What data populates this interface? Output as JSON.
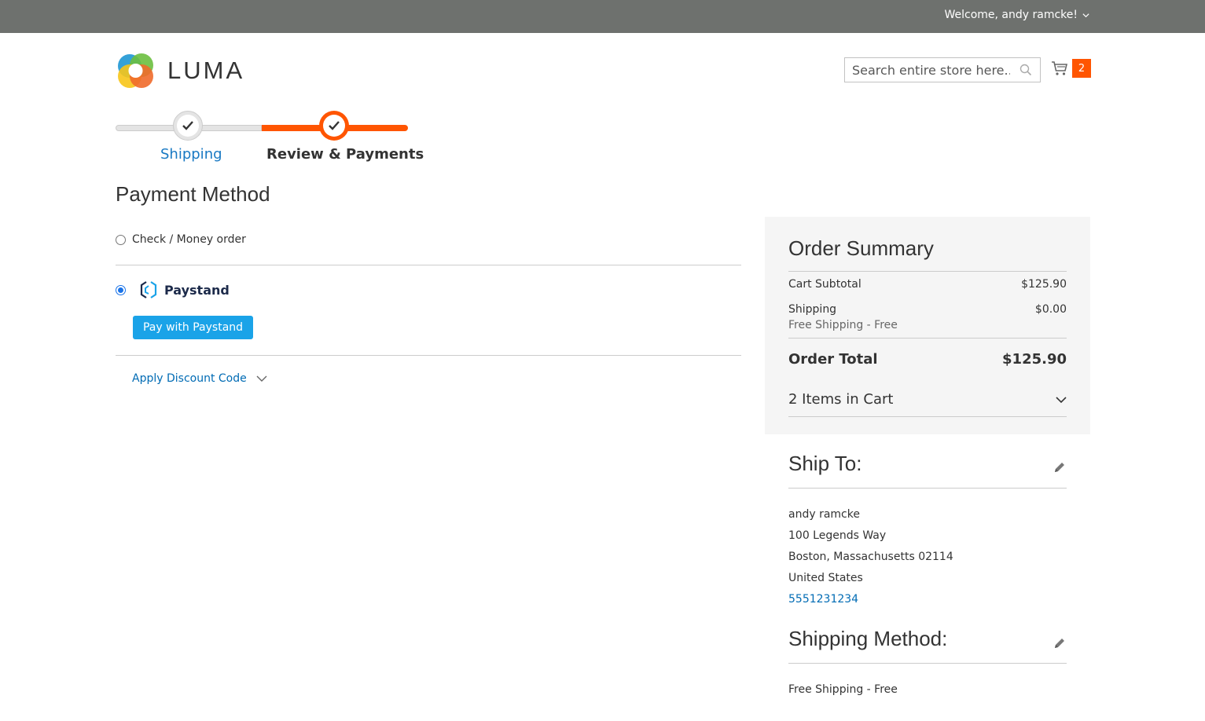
{
  "header": {
    "welcome_text": "Welcome, andy ramcke!",
    "logo_text": "LUMA",
    "search_placeholder": "Search entire store here...",
    "cart_count": "2"
  },
  "progress": {
    "steps": [
      {
        "label": "Shipping",
        "state": "complete"
      },
      {
        "label": "Review & Payments",
        "state": "active"
      }
    ]
  },
  "payment": {
    "title": "Payment Method",
    "methods": [
      {
        "label": "Check / Money order",
        "selected": false
      },
      {
        "label": "Paystand",
        "selected": true
      }
    ],
    "pay_button": "Pay with Paystand",
    "discount_label": "Apply Discount Code"
  },
  "summary": {
    "title": "Order Summary",
    "subtotal_label": "Cart Subtotal",
    "subtotal_value": "$125.90",
    "shipping_label": "Shipping",
    "shipping_value": "$0.00",
    "shipping_method": "Free Shipping - Free",
    "total_label": "Order Total",
    "total_value": "$125.90",
    "items_label": "2 Items in Cart"
  },
  "ship_to": {
    "title": "Ship To:",
    "name": "andy ramcke",
    "street": "100 Legends Way",
    "city_line": "Boston, Massachusetts 02114",
    "country": "United States",
    "phone": "5551231234"
  },
  "shipping_method": {
    "title": "Shipping Method:",
    "value": "Free Shipping - Free"
  },
  "colors": {
    "accent": "#ff5501",
    "link": "#1979c3",
    "button": "#1aa3e8",
    "topbar": "#6e716e"
  }
}
